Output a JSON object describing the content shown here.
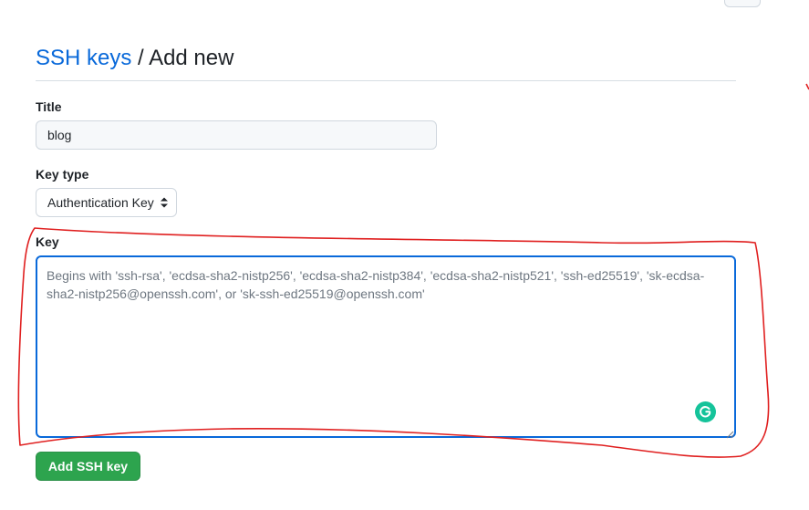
{
  "breadcrumb": {
    "parent_label": "SSH keys",
    "separator": "/",
    "current_label": "Add new"
  },
  "form": {
    "title_label": "Title",
    "title_value": "blog",
    "key_type_label": "Key type",
    "key_type_value": "Authentication Key",
    "key_label": "Key",
    "key_placeholder": "Begins with 'ssh-rsa', 'ecdsa-sha2-nistp256', 'ecdsa-sha2-nistp384', 'ecdsa-sha2-nistp521', 'ssh-ed25519', 'sk-ecdsa-sha2-nistp256@openssh.com', or 'sk-ssh-ed25519@openssh.com'",
    "submit_label": "Add SSH key"
  },
  "icons": {
    "select_caret": "updown-caret-icon",
    "grammarly": "grammarly-icon",
    "resize": "resize-handle-icon"
  },
  "colors": {
    "link": "#0969da",
    "focus_border": "#0969da",
    "primary_button": "#2da44e",
    "annotation": "#e02020",
    "grammarly": "#15c39a"
  }
}
